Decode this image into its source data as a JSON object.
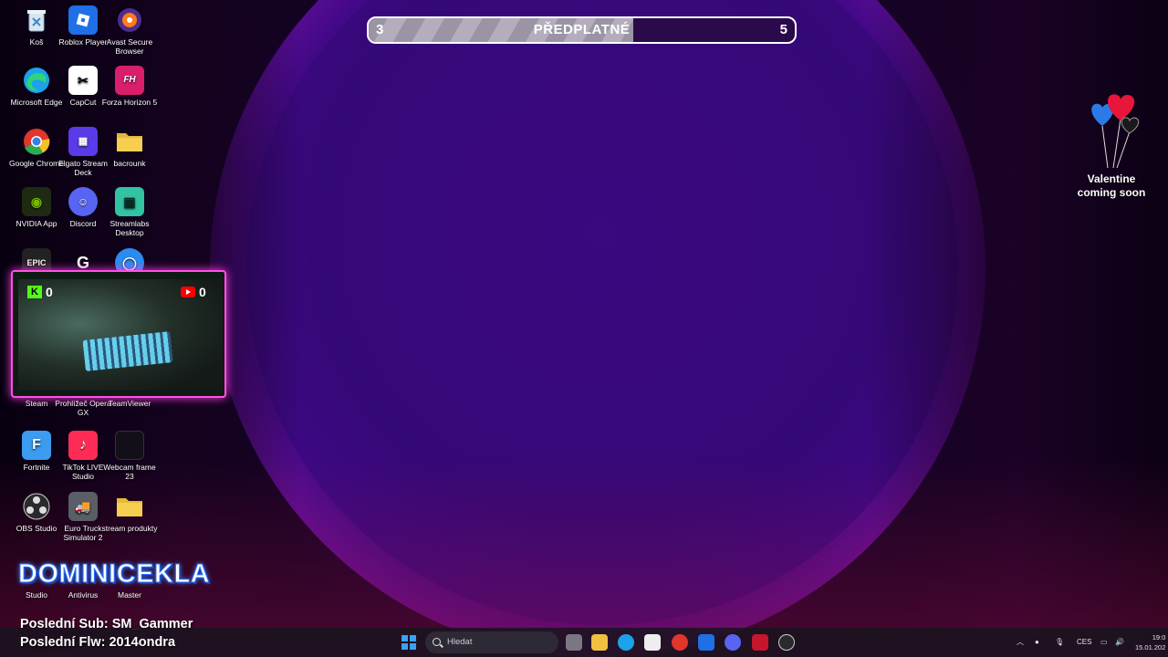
{
  "desktop_icons": [
    {
      "label": "Koš"
    },
    {
      "label": "Roblox Player"
    },
    {
      "label": "Avast Secure Browser"
    },
    {
      "label": "Microsoft Edge"
    },
    {
      "label": "CapCut"
    },
    {
      "label": "Forza Horizon 5"
    },
    {
      "label": "Google Chrome"
    },
    {
      "label": "Elgato Stream Deck"
    },
    {
      "label": "bacrounk"
    },
    {
      "label": "NVIDIA App"
    },
    {
      "label": "Discord"
    },
    {
      "label": "Streamlabs Desktop"
    },
    {
      "label": "Steam"
    },
    {
      "label": "Prohlížeč Opera GX"
    },
    {
      "label": "TeamViewer"
    },
    {
      "label": "Fortnite"
    },
    {
      "label": "TikTok LIVE Studio"
    },
    {
      "label": "Webcam frame 23"
    },
    {
      "label": "OBS Studio"
    },
    {
      "label": "Euro Truck Simulator 2"
    },
    {
      "label": "stream produkty"
    },
    {
      "label": "Studio"
    },
    {
      "label": "Antivirus"
    },
    {
      "label": "Master"
    }
  ],
  "goal_bar": {
    "start": "3",
    "label": "PŘEDPLATNÉ",
    "end": "5",
    "progress": 0.62
  },
  "valentine": {
    "line1": "Valentine",
    "line2": "coming soon"
  },
  "webcam": {
    "kick_count": "0",
    "youtube_count": "0"
  },
  "streamer": {
    "name": "DOMINICEKLA",
    "last_sub": "Poslední Sub: SM_Gammer",
    "last_follow": "Poslední Flw: 2014ondra"
  },
  "taskbar": {
    "search_placeholder": "Hledat",
    "language": "CES",
    "time": "19:0",
    "date": "15.01.202"
  },
  "colors": {
    "accent_pink": "#ff4fe8",
    "goal_fill": "#a8a2b0",
    "windows_blue": "#3aa0ff"
  }
}
